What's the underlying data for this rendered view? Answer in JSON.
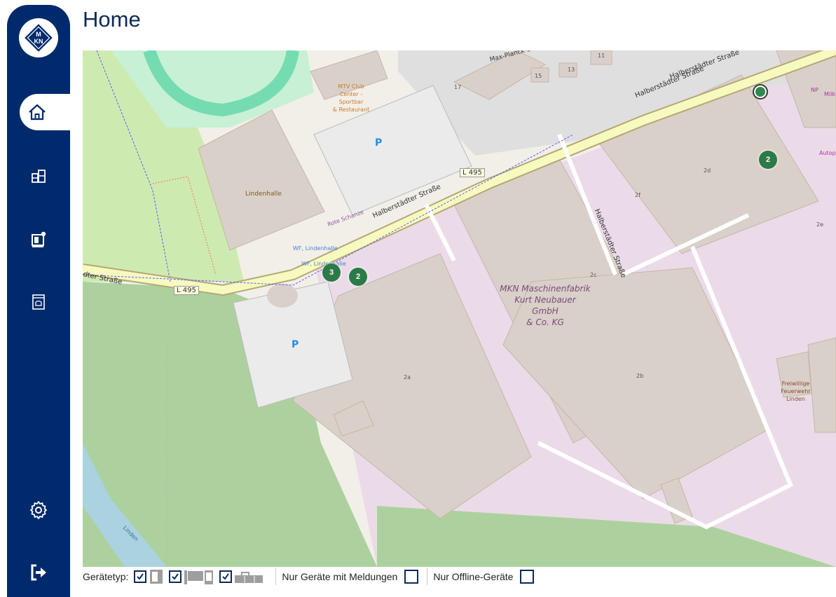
{
  "app": {
    "logo_text": "MKN",
    "page_title": "Home"
  },
  "sidebar": {
    "items": [
      {
        "icon": "home-icon",
        "active": true
      },
      {
        "icon": "devices-icon",
        "active": false
      },
      {
        "icon": "device-notification-icon",
        "active": false
      },
      {
        "icon": "cookbook-icon",
        "active": false
      },
      {
        "icon": "gear-icon",
        "active": false
      },
      {
        "icon": "logout-icon",
        "active": false
      }
    ]
  },
  "map": {
    "labels": {
      "street_halberstaedter_1": "Halberstädter Straße",
      "street_halberstaedter_2": "Halberstädter Straße",
      "street_halberstaedter_3": "Halberstädter Straße",
      "street_halberstaedter_4": "Halberstädter Straße",
      "street_left": "dter Straße",
      "street_max_planck": "Max-Planck-Str.",
      "road_l495_a": "L 495",
      "road_l495_b": "L 495",
      "rote_schanze": "Rote Schanze",
      "lindenhalle": "Lindenhalle",
      "bus_stop_1": "WF, Lindenhalle",
      "bus_stop_2": "WF, Lindenhalle",
      "mtv_1": "MTV Club",
      "mtv_2": "Center -",
      "mtv_3": "Sportbar",
      "mtv_4": "& Restaurant",
      "mkn_1": "MKN Maschinenfabrik",
      "mkn_2": "Kurt Neubauer",
      "mkn_3": "GmbH",
      "mkn_4": "& Co. KG",
      "feuerwehr_1": "Freiwillige",
      "feuerwehr_2": "Feuerwehr",
      "feuerwehr_3": "Linden",
      "parking_1": "P",
      "parking_2": "P",
      "house_17": "17",
      "house_15": "15",
      "house_13": "13",
      "house_11": "11",
      "bldg_2a": "2a",
      "bldg_2b": "2b",
      "bldg_2c": "2c",
      "bldg_2d": "2d",
      "bldg_2e": "2e",
      "bldg_2f": "2f",
      "np": "NP",
      "milk": "Milk",
      "auto": "Autop",
      "river": "Linden"
    },
    "clusters": [
      {
        "count": "3"
      },
      {
        "count": "2"
      },
      {
        "count": "2"
      }
    ],
    "device_marker": {
      "status_color": "#2c8a4e"
    }
  },
  "filters": {
    "device_type_label": "Gerätetyp:",
    "device_types": [
      {
        "icon": "combi-steamer-icon",
        "checked": true
      },
      {
        "icon": "cooking-line-icon",
        "checked": true
      },
      {
        "icon": "kettle-icon",
        "checked": true
      }
    ],
    "only_messages_label": "Nur Geräte mit Meldungen",
    "only_messages_checked": false,
    "only_offline_label": "Nur Offline-Geräte",
    "only_offline_checked": false
  },
  "colors": {
    "sidebar": "#002a6c",
    "title": "#0b2a57",
    "marker_green": "#2c7a48"
  }
}
